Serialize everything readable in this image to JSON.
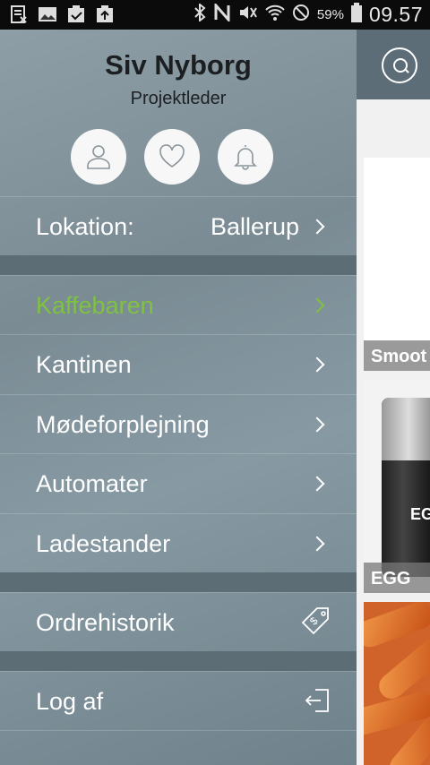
{
  "status_bar": {
    "battery": "59%",
    "time": "09.57"
  },
  "profile": {
    "name": "Siv Nyborg",
    "role": "Projektleder",
    "icons": [
      "user-icon",
      "heart-icon",
      "bell-icon"
    ]
  },
  "location": {
    "label": "Lokation:",
    "value": "Ballerup"
  },
  "menu": {
    "items": [
      {
        "label": "Kaffebaren",
        "active": true
      },
      {
        "label": "Kantinen"
      },
      {
        "label": "Mødeforplejning"
      },
      {
        "label": "Automater"
      },
      {
        "label": "Ladestander"
      }
    ]
  },
  "order_history": {
    "label": "Ordrehistorik",
    "icon": "tag-icon"
  },
  "logout": {
    "label": "Log af",
    "icon": "logout-icon"
  },
  "background": {
    "cards": [
      {
        "label": "Smoot"
      },
      {
        "label": "EGG",
        "text": "EG"
      }
    ]
  },
  "colors": {
    "accent_active": "#7fc241",
    "drawer": "#7f9098",
    "divider": "#5c6d76"
  }
}
